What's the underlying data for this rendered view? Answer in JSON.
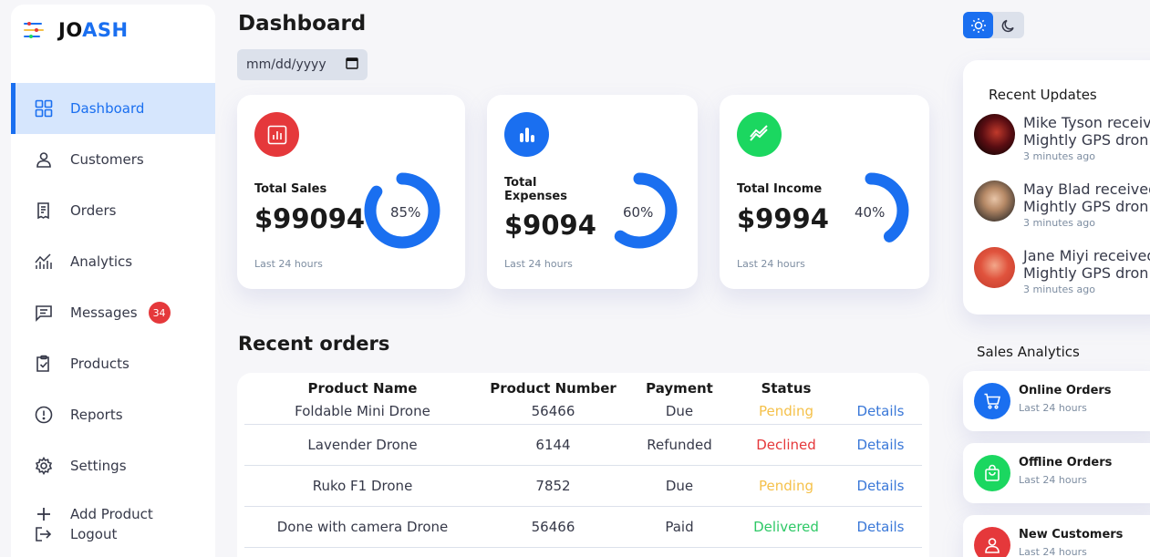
{
  "app": {
    "logo_prefix": "JO",
    "logo_suffix": "ASH"
  },
  "sidebar": {
    "items": [
      {
        "label": "Dashboard",
        "icon": "dashboard-grid-icon",
        "active": true
      },
      {
        "label": "Customers",
        "icon": "user-icon"
      },
      {
        "label": "Orders",
        "icon": "receipt-icon"
      },
      {
        "label": "Analytics",
        "icon": "analytics-icon"
      },
      {
        "label": "Messages",
        "icon": "message-icon",
        "badge": "34"
      },
      {
        "label": "Products",
        "icon": "clipboard-check-icon"
      },
      {
        "label": "Reports",
        "icon": "alert-circle-icon"
      },
      {
        "label": "Settings",
        "icon": "gear-icon"
      }
    ],
    "add_product": "Add Product",
    "logout": "Logout"
  },
  "header": {
    "title": "Dashboard",
    "date_placeholder": "mm/dd/yyyy"
  },
  "cards": [
    {
      "label": "Total Sales",
      "value": "$99094",
      "percent_text": "85%",
      "percent": 85,
      "foot": "Last 24 hours",
      "icon": "bar-chart-icon",
      "color": "#e5383b"
    },
    {
      "label": "Total Expenses",
      "value": "$9094",
      "percent_text": "60%",
      "percent": 60,
      "foot": "Last 24 hours",
      "icon": "stats-icon",
      "color": "#1a6ff0"
    },
    {
      "label": "Total Income",
      "value": "$9994",
      "percent_text": "40%",
      "percent": 40,
      "foot": "Last 24 hours",
      "icon": "trend-up-icon",
      "color": "#1bd760"
    }
  ],
  "orders": {
    "title": "Recent orders",
    "columns": [
      "Product Name",
      "Product Number",
      "Payment",
      "Status",
      ""
    ],
    "rows": [
      {
        "name": "Foldable Mini Drone",
        "number": "56466",
        "payment": "Due",
        "status": "Pending",
        "details": "Details"
      },
      {
        "name": "Lavender Drone",
        "number": "6144",
        "payment": "Refunded",
        "status": "Declined",
        "details": "Details"
      },
      {
        "name": "Ruko F1 Drone",
        "number": "7852",
        "payment": "Due",
        "status": "Pending",
        "details": "Details"
      },
      {
        "name": "Done with camera Drone",
        "number": "56466",
        "payment": "Paid",
        "status": "Delivered",
        "details": "Details"
      }
    ]
  },
  "updates": {
    "title": "Recent Updates",
    "items": [
      {
        "line1": "Mike Tyson receiv",
        "line2": "Mightly GPS dron",
        "time": "3 minutes ago"
      },
      {
        "line1": "May Blad received",
        "line2": "Mightly GPS dron",
        "time": "3 minutes ago"
      },
      {
        "line1": "Jane Miyi received",
        "line2": "Mightly GPS dron",
        "time": "3 minutes ago"
      }
    ]
  },
  "analytics": {
    "title": "Sales Analytics",
    "items": [
      {
        "label": "Online Orders",
        "sub": "Last 24 hours",
        "icon": "cart-icon",
        "color": "#1a6ff0"
      },
      {
        "label": "Offline Orders",
        "sub": "Last 24 hours",
        "icon": "shopping-bag-icon",
        "color": "#1bd760"
      },
      {
        "label": "New Customers",
        "sub": "Last 24 hours",
        "icon": "user-icon",
        "color": "#e5383b"
      }
    ]
  },
  "theme": {
    "active": "light"
  }
}
